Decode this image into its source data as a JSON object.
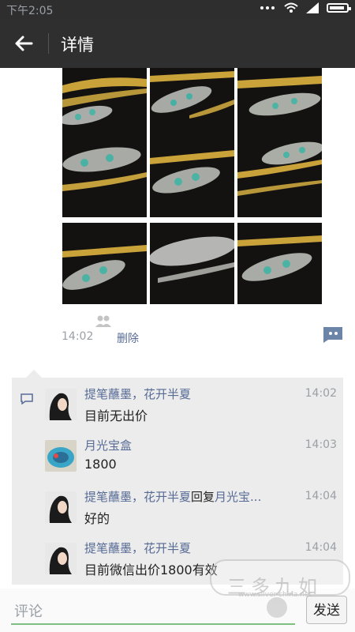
{
  "statusbar": {
    "time": "下午2:05"
  },
  "appbar": {
    "title": "详情"
  },
  "post": {
    "time": "14:02",
    "delete_label": "删除"
  },
  "comments": [
    {
      "name": "提笔蘸墨，花开半夏",
      "reply_word": "",
      "reply_to": "",
      "time": "14:02",
      "text": "目前无出价",
      "avatar": "portrait"
    },
    {
      "name": "月光宝盒",
      "reply_word": "",
      "reply_to": "",
      "time": "14:03",
      "text": "1800",
      "avatar": "box"
    },
    {
      "name": "提笔蘸墨，花开半夏",
      "reply_word": "回复",
      "reply_to": "月光宝...",
      "time": "14:04",
      "text": "好的",
      "avatar": "portrait"
    },
    {
      "name": "提笔蘸墨，花开半夏",
      "reply_word": "",
      "reply_to": "",
      "time": "14:04",
      "text": "目前微信出价1800有效",
      "avatar": "portrait"
    }
  ],
  "input": {
    "placeholder": "评论",
    "send_label": "发送"
  },
  "watermark": {
    "text": "三多九如",
    "url": "www.silver-china.net"
  },
  "colors": {
    "link": "#576b95",
    "appbar": "#2f2f30",
    "statusbar": "#2e2e2e"
  }
}
